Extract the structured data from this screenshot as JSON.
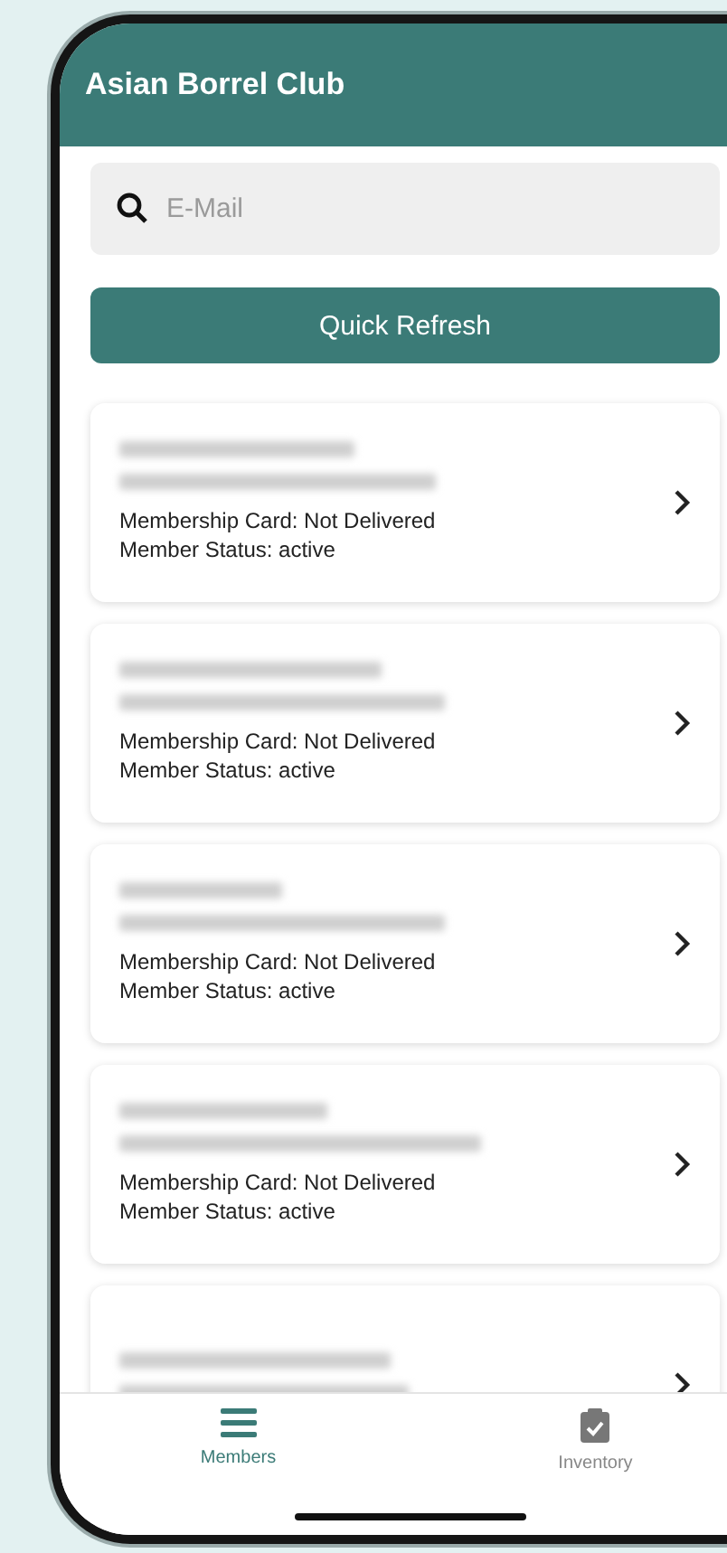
{
  "app_bar": {
    "title": "Asian Borrel Club"
  },
  "search": {
    "placeholder": "E-Mail"
  },
  "refresh_button": {
    "label": "Quick Refresh"
  },
  "members": [
    {
      "card_status": "Membership Card: Not Delivered",
      "member_status": "Member Status: active"
    },
    {
      "card_status": "Membership Card: Not Delivered",
      "member_status": "Member Status: active"
    },
    {
      "card_status": "Membership Card: Not Delivered",
      "member_status": "Member Status: active"
    },
    {
      "card_status": "Membership Card: Not Delivered",
      "member_status": "Member Status: active"
    }
  ],
  "tabs": [
    {
      "kind": "list",
      "label": "Members",
      "selected": true
    },
    {
      "kind": "clipboard",
      "label": "Inventory",
      "selected": false
    }
  ]
}
